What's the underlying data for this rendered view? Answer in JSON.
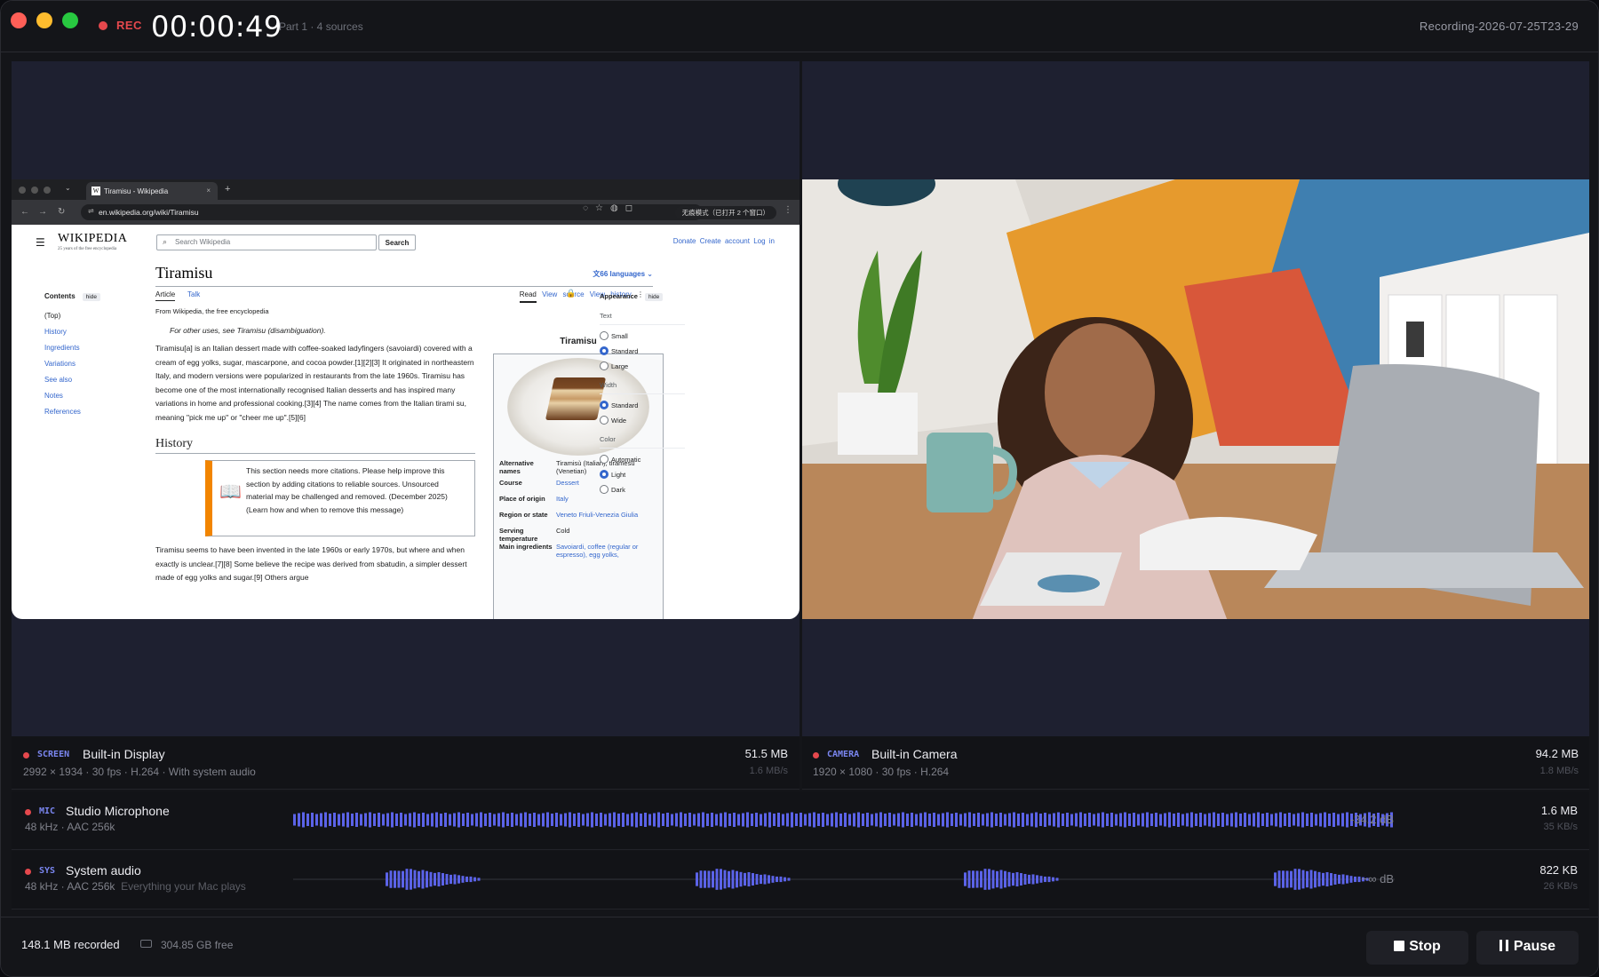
{
  "header": {
    "rec_label": "REC",
    "timer": "00:00:49",
    "part_info": "Part 1 · 4 sources",
    "filename": "Recording-2026-07-25T23-29"
  },
  "browser": {
    "tab_title": "Tiramisu - Wikipedia",
    "url": "en.wikipedia.org/wiki/Tiramisu",
    "incognito": "无痕模式（已打开 2 个窗口）",
    "wiki": {
      "logo": "WIKIPEDIA",
      "tagline": "25 years of the free encyclopedia",
      "search_placeholder": "Search Wikipedia",
      "search_button": "Search",
      "top_links": "Donate  Create account  Log in",
      "toc_title": "Contents",
      "hide": "hide",
      "toc_items": [
        "(Top)",
        "History",
        "Ingredients",
        "Variations",
        "See also",
        "Notes",
        "References"
      ],
      "title": "Tiramisu",
      "languages": "66 languages",
      "tab_article": "Article",
      "tab_talk": "Talk",
      "tab_read": "Read",
      "tab_view_source": "View source",
      "tab_view_history": "View history",
      "from": "From Wikipedia, the free encyclopedia",
      "hatnote": "For other uses, see Tiramisu (disambiguation).",
      "intro": "Tiramisu[a] is an Italian dessert made with coffee-soaked ladyfingers (savoiardi) covered with a cream of egg yolks, sugar, mascarpone, and cocoa powder.[1][2][3] It originated in northeastern Italy, and modern versions were popularized in restaurants from the late 1960s. Tiramisu has become one of the most internationally recognised Italian desserts and has inspired many variations in home and professional cooking.[3][4] The name comes from the Italian tirami su, meaning \"pick me up\" or \"cheer me up\".[5][6]",
      "history_heading": "History",
      "ambox": "This section needs more citations. Please help improve this section by adding citations to reliable sources. Unsourced material may be challenged and removed. (December 2025) (Learn how and when to remove this message)",
      "history_text": "Tiramisu seems to have been invented in the late 1960s or early 1970s, but where and when exactly is unclear.[7][8] Some believe the recipe was derived from sbatudin, a simpler dessert made of egg yolks and sugar.[9] Others argue",
      "infobox": {
        "title": "Tiramisu",
        "rows": [
          {
            "k": "Alternative names",
            "v": "Tiramisù (Italian), tiramesù (Venetian)"
          },
          {
            "k": "Course",
            "v": "Dessert"
          },
          {
            "k": "Place of origin",
            "v": "Italy"
          },
          {
            "k": "Region or state",
            "v": "Veneto Friuli-Venezia Giulia"
          },
          {
            "k": "Serving temperature",
            "v": "Cold"
          },
          {
            "k": "Main ingredients",
            "v": "Savoiardi, coffee (regular or espresso), egg yolks,"
          }
        ]
      },
      "appearance": {
        "title": "Appearance",
        "hide": "hide",
        "text_label": "Text",
        "text_options": [
          "Small",
          "Standard",
          "Large"
        ],
        "width_label": "Width",
        "width_options": [
          "Standard",
          "Wide"
        ],
        "color_label": "Color",
        "color_options": [
          "Automatic",
          "Light",
          "Dark"
        ]
      }
    }
  },
  "tracks": {
    "screen": {
      "tag": "SCREEN",
      "name": "Built-in Display",
      "meta": "2992 × 1934 · 30 fps · H.264 · With system audio",
      "size": "51.5 MB",
      "rate": "1.6 MB/s"
    },
    "camera": {
      "tag": "CAMERA",
      "name": "Built-in Camera",
      "meta": "1920 × 1080 · 30 fps · H.264",
      "size": "94.2 MB",
      "rate": "1.8 MB/s"
    },
    "mic": {
      "tag": "MIC",
      "name": "Studio Microphone",
      "meta": "48 kHz · AAC 256k",
      "db": "-34.2 dB",
      "size": "1.6 MB",
      "rate": "35 KB/s"
    },
    "sys": {
      "tag": "SYS",
      "name": "System audio",
      "meta": "48 kHz · AAC 256k",
      "note": "Everything your Mac plays",
      "db": "−∞ dB",
      "size": "822 KB",
      "rate": "26 KB/s"
    }
  },
  "footer": {
    "recorded": "148.1 MB recorded",
    "free": "304.85 GB free",
    "stop": "Stop",
    "pause": "Pause"
  },
  "colors": {
    "accent": "#7a86f0",
    "record": "#e5484d",
    "wave": "#5b63e8"
  }
}
